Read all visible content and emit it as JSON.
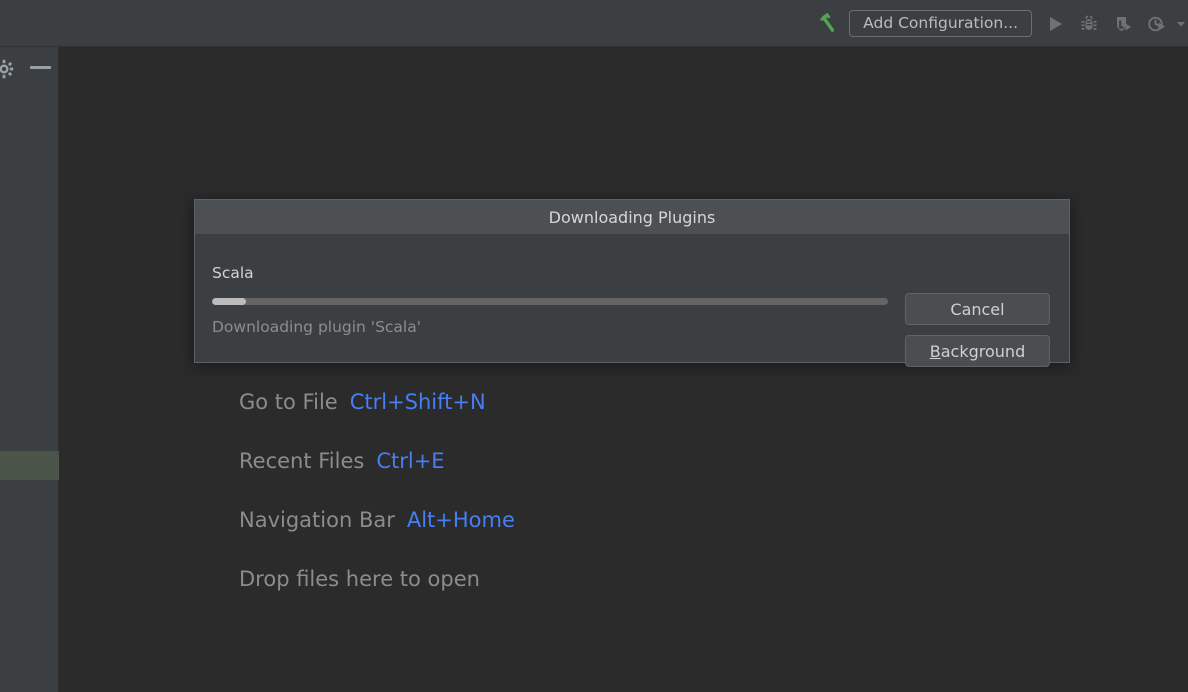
{
  "toolbar": {
    "build_icon": "hammer-icon",
    "add_configuration_label": "Add Configuration...",
    "run_icon": "run-icon",
    "debug_icon": "debug-bug-icon",
    "run_coverage_icon": "run-with-coverage-icon",
    "profiler_icon": "run-with-profiler-icon",
    "overflow_icon": "chevron-down-icon",
    "accent_green": "#54a354"
  },
  "sidebar": {
    "settings_icon": "gear-icon",
    "minimize_icon": "minimize-icon",
    "selection_color": "#4b5449"
  },
  "editor": {
    "shortcuts": [
      {
        "label": "Go to File",
        "key": "Ctrl+Shift+N"
      },
      {
        "label": "Recent Files",
        "key": "Ctrl+E"
      },
      {
        "label": "Navigation Bar",
        "key": "Alt+Home"
      }
    ],
    "drop_hint": "Drop files here to open",
    "key_color": "#467ff2",
    "label_color": "#8c8c8c"
  },
  "dialog": {
    "title": "Downloading Plugins",
    "progress_name": "Scala",
    "progress_status": "Downloading plugin 'Scala'",
    "progress_percent": 5,
    "cancel_label": "Cancel",
    "background_mnemonic": "B",
    "background_rest": "ackground"
  }
}
